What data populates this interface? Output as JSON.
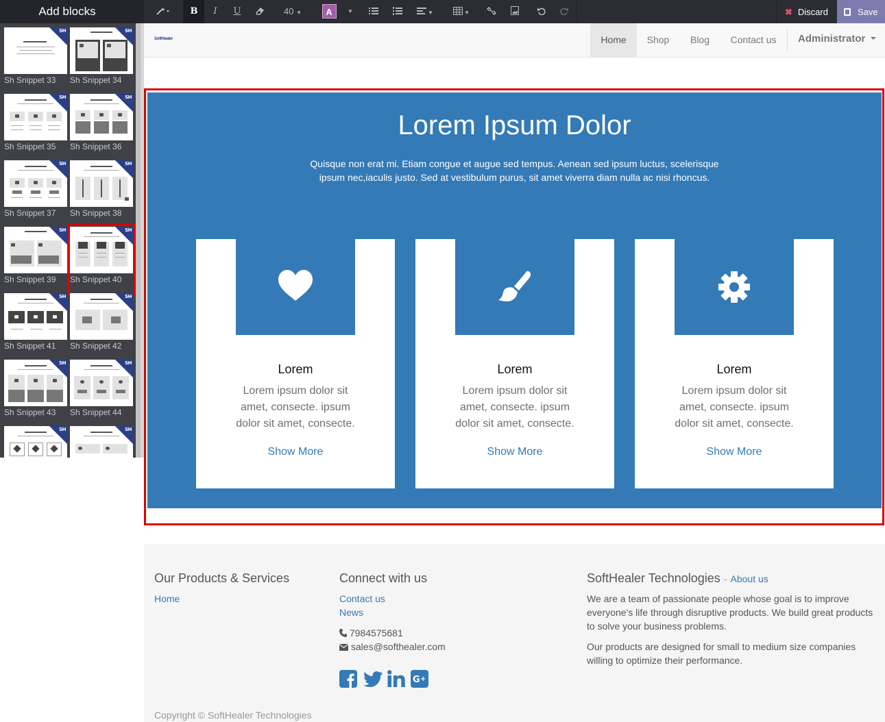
{
  "sidebar": {
    "title": "Add blocks",
    "badge": "SH",
    "snippets": [
      {
        "label": "Sh Snippet 33"
      },
      {
        "label": "Sh Snippet 34"
      },
      {
        "label": "Sh Snippet 35"
      },
      {
        "label": "Sh Snippet 36"
      },
      {
        "label": "Sh Snippet 37"
      },
      {
        "label": "Sh Snippet 38"
      },
      {
        "label": "Sh Snippet 39"
      },
      {
        "label": "Sh Snippet 40"
      },
      {
        "label": "Sh Snippet 41"
      },
      {
        "label": "Sh Snippet 42"
      },
      {
        "label": "Sh Snippet 43"
      },
      {
        "label": "Sh Snippet 44"
      }
    ],
    "selected_snippet": "Sh Snippet 40"
  },
  "toolbar": {
    "bold": "B",
    "italic": "I",
    "underline": "U",
    "font_size": "40",
    "color_letter": "A",
    "discard_label": "Discard",
    "save_label": "Save",
    "accent_color": "#7c7bad"
  },
  "navbar": {
    "logo_text": "SoftHealer",
    "items": [
      {
        "label": "Home",
        "active": true
      },
      {
        "label": "Shop"
      },
      {
        "label": "Blog"
      },
      {
        "label": "Contact us"
      }
    ],
    "user": "Administrator"
  },
  "hero": {
    "title": "Lorem Ipsum Dolor",
    "text": "Quisque non erat mi. Etiam congue et augue sed tempus. Aenean sed ipsum luctus, scelerisque ipsum nec,iaculis justo. Sed at vestibulum purus, sit amet viverra diam nulla ac nisi rhoncus.",
    "background_color": "#337ab7",
    "cards": [
      {
        "icon": "heart-icon",
        "title": "Lorem",
        "text": "Lorem ipsum dolor sit amet, consecte. ipsum dolor sit amet, consecte.",
        "link": "Show More"
      },
      {
        "icon": "paintbrush-icon",
        "title": "Lorem",
        "text": "Lorem ipsum dolor sit amet, consecte. ipsum dolor sit amet, consecte.",
        "link": "Show More"
      },
      {
        "icon": "gear-icon",
        "title": "Lorem",
        "text": "Lorem ipsum dolor sit amet, consecte. ipsum dolor sit amet, consecte.",
        "link": "Show More"
      }
    ]
  },
  "footer": {
    "products_heading": "Our Products & Services",
    "products_links": [
      "Home"
    ],
    "connect_heading": "Connect with us",
    "connect_links": [
      "Contact us",
      "News"
    ],
    "phone": "7984575681",
    "email": "sales@softhealer.com",
    "social": [
      "facebook-icon",
      "twitter-icon",
      "linkedin-icon",
      "google-plus-icon"
    ],
    "company_heading": "SoftHealer Technologies",
    "about_link": "About us",
    "about_text_1": "We are a team of passionate people whose goal is to improve everyone's life through disruptive products. We build great products to solve your business problems.",
    "about_text_2": "Our products are designed for small to medium size companies willing to optimize their performance.",
    "copyright": "Copyright © SoftHealer Technologies"
  }
}
